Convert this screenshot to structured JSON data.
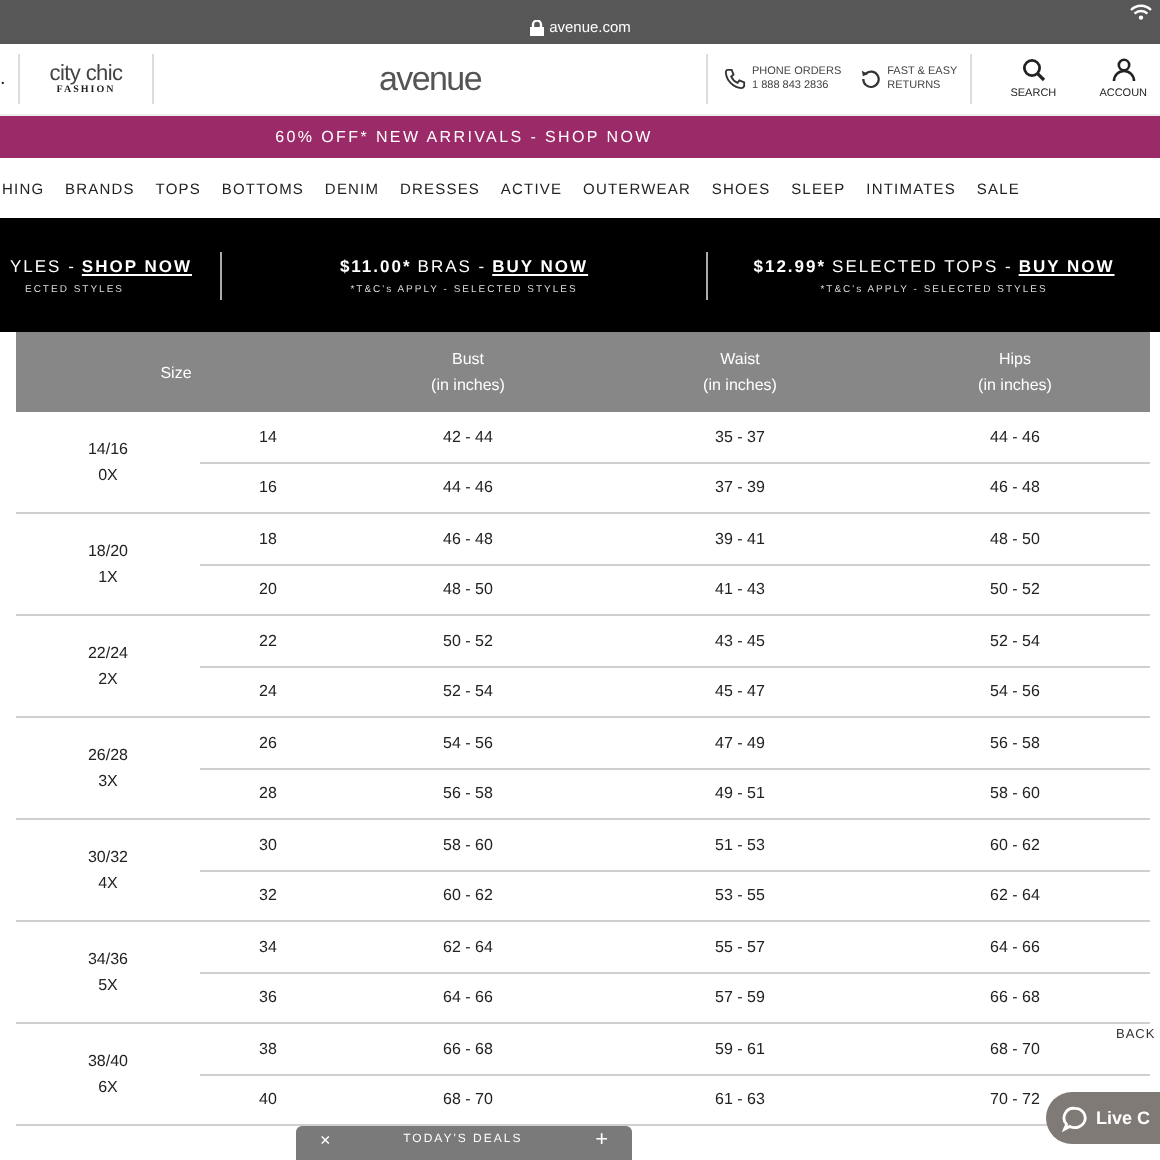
{
  "browser": {
    "url": "avenue.com"
  },
  "header": {
    "left_mark": ".",
    "partner": {
      "name": "city chic",
      "sub": "FASHION"
    },
    "logo": "avenue",
    "phone": {
      "label": "PHONE ORDERS",
      "number": "1 888 843 2836"
    },
    "returns": {
      "line1": "FAST & EASY",
      "line2": "RETURNS"
    },
    "actions": [
      {
        "kind": "search",
        "label": "SEARCH"
      },
      {
        "kind": "account",
        "label": "ACCOUN"
      }
    ]
  },
  "promo_banner": "60% OFF* NEW ARRIVALS - SHOP NOW",
  "nav": [
    "HING",
    "BRANDS",
    "TOPS",
    "BOTTOMS",
    "DENIM",
    "DRESSES",
    "ACTIVE",
    "OUTERWEAR",
    "SHOES",
    "SLEEP",
    "INTIMATES",
    "SALE"
  ],
  "offers": [
    {
      "label": "YLES -",
      "link": "SHOP NOW",
      "note": "ECTED STYLES"
    },
    {
      "price": "$11.00*",
      "label": "BRAS -",
      "link": "BUY NOW",
      "note": "*T&C's APPLY - SELECTED STYLES"
    },
    {
      "price": "$12.99*",
      "label": "SELECTED TOPS -",
      "link": "BUY NOW",
      "note": "*T&C's APPLY - SELECTED STYLES"
    }
  ],
  "table": {
    "columns": [
      {
        "label": "Size"
      },
      {
        "label": "Bust",
        "sub": "(in inches)"
      },
      {
        "label": "Waist",
        "sub": "(in inches)"
      },
      {
        "label": "Hips",
        "sub": "(in inches)"
      }
    ],
    "groups": [
      {
        "size": "14/16",
        "plus": "0X",
        "rows": [
          [
            "14",
            "42 - 44",
            "35 - 37",
            "44 - 46"
          ],
          [
            "16",
            "44 - 46",
            "37 - 39",
            "46 - 48"
          ]
        ]
      },
      {
        "size": "18/20",
        "plus": "1X",
        "rows": [
          [
            "18",
            "46 - 48",
            "39 - 41",
            "48 - 50"
          ],
          [
            "20",
            "48 - 50",
            "41 - 43",
            "50 - 52"
          ]
        ]
      },
      {
        "size": "22/24",
        "plus": "2X",
        "rows": [
          [
            "22",
            "50 - 52",
            "43 - 45",
            "52 - 54"
          ],
          [
            "24",
            "52 - 54",
            "45 - 47",
            "54 - 56"
          ]
        ]
      },
      {
        "size": "26/28",
        "plus": "3X",
        "rows": [
          [
            "26",
            "54 - 56",
            "47 - 49",
            "56 - 58"
          ],
          [
            "28",
            "56 - 58",
            "49 - 51",
            "58 - 60"
          ]
        ]
      },
      {
        "size": "30/32",
        "plus": "4X",
        "rows": [
          [
            "30",
            "58 - 60",
            "51 - 53",
            "60 - 62"
          ],
          [
            "32",
            "60 - 62",
            "53 - 55",
            "62 - 64"
          ]
        ]
      },
      {
        "size": "34/36",
        "plus": "5X",
        "rows": [
          [
            "34",
            "62 - 64",
            "55 - 57",
            "64 - 66"
          ],
          [
            "36",
            "64 - 66",
            "57 - 59",
            "66 - 68"
          ]
        ]
      },
      {
        "size": "38/40",
        "plus": "6X",
        "rows": [
          [
            "38",
            "66 - 68",
            "59 - 61",
            "68 - 70"
          ],
          [
            "40",
            "68 - 70",
            "61 - 63",
            "70 - 72"
          ]
        ]
      }
    ]
  },
  "deals_bar": {
    "close": "×",
    "label": "TODAY'S DEALS",
    "expand": "+"
  },
  "back_to_top": "BACK",
  "live_chat": "Live C"
}
